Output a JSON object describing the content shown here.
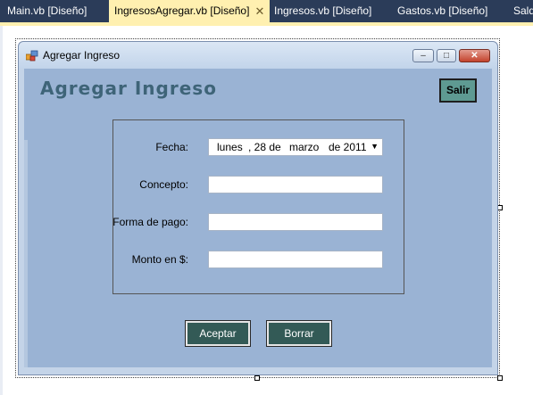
{
  "ide_tabs": [
    {
      "label": "Main.vb [Diseño]",
      "active": false
    },
    {
      "label": "IngresosAgregar.vb [Diseño]",
      "active": true
    },
    {
      "label": "Ingresos.vb [Diseño]",
      "active": false
    },
    {
      "label": "Gastos.vb [Diseño]",
      "active": false
    },
    {
      "label": "Saldo",
      "active": false
    }
  ],
  "window": {
    "title": "Agregar Ingreso",
    "controls": {
      "minimize": "–",
      "maximize": "□",
      "close": "✕"
    }
  },
  "form": {
    "heading": "Agregar Ingreso",
    "exit_button": "Salir",
    "fields": {
      "fecha": {
        "label": "Fecha:",
        "weekday": "lunes",
        "day": ", 28 de",
        "month": "marzo",
        "year": "de 2011"
      },
      "concepto": {
        "label": "Concepto:",
        "value": ""
      },
      "forma_pago": {
        "label": "Forma de pago:",
        "value": ""
      },
      "monto": {
        "label": "Monto en $:",
        "value": ""
      }
    },
    "accept_button": "Aceptar",
    "clear_button": "Borrar"
  },
  "colors": {
    "ide_tabstrip": "#2b3c59",
    "active_tab": "#fff0b0",
    "form_client": "#9ab3d4",
    "heading": "#3e6478",
    "exit_button": "#5e9a92",
    "action_buttons": "#335a56"
  }
}
